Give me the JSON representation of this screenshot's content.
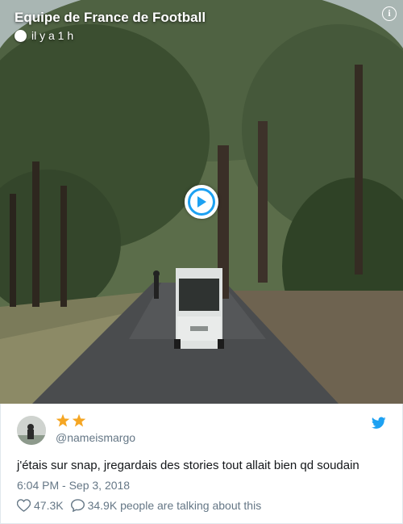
{
  "video": {
    "snap_title": "Equipe de France de Football",
    "snap_time": "il y a 1 h",
    "info_icon": "info-icon",
    "play_icon": "play-icon"
  },
  "tweet": {
    "display_name_emoji": [
      "star-emoji",
      "star-emoji"
    ],
    "handle": "@nameismargo",
    "text": "j'étais sur snap, jregardais des stories tout allait bien qd soudain",
    "timestamp": "6:04 PM - Sep 3, 2018",
    "likes": "47.3K",
    "replies_label": "34.9K people are talking about this"
  },
  "colors": {
    "accent": "#1da1f2",
    "muted": "#657786",
    "text": "#14171a",
    "star": "#f5a623"
  }
}
